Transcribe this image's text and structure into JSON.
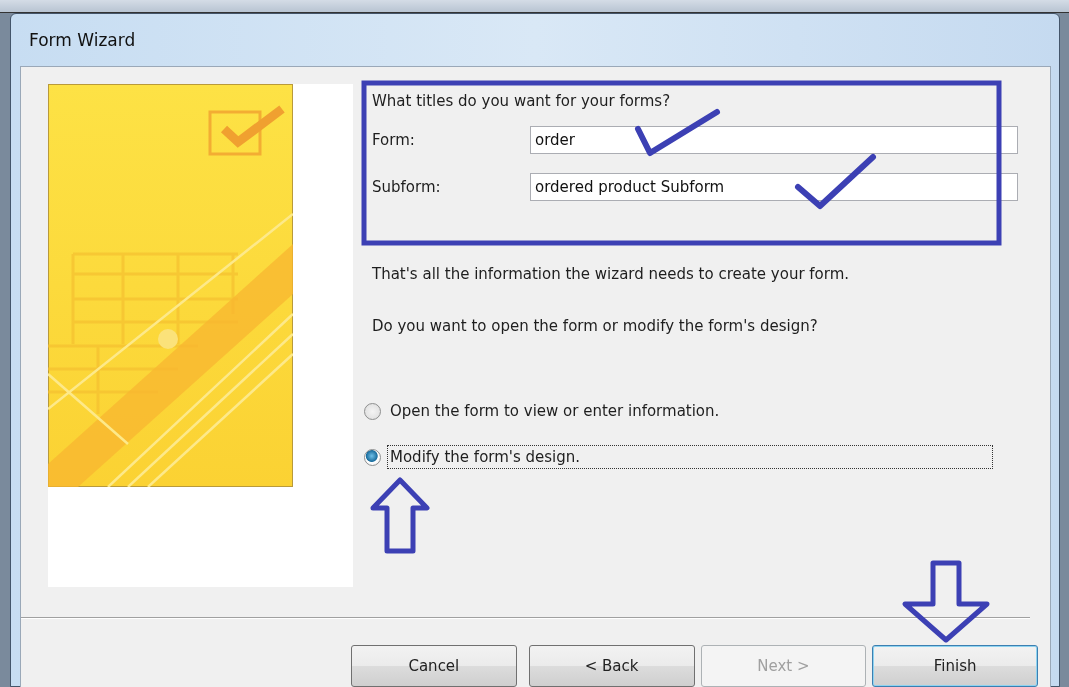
{
  "window": {
    "title": "Form Wizard"
  },
  "heading": "What titles do you want for your forms?",
  "fields": [
    {
      "label": "Form:",
      "value": "order"
    },
    {
      "label": "Subform:",
      "value": "ordered product Subform"
    }
  ],
  "messages": [
    "That's all the information the wizard needs to create your form.",
    "Do you want to open the form or modify the form's design?"
  ],
  "options": [
    {
      "label": "Open the form to view or enter information.",
      "selected": false
    },
    {
      "label": "Modify the form's design.",
      "selected": true
    }
  ],
  "buttons": [
    {
      "label": "Cancel",
      "disabled": false,
      "default": false
    },
    {
      "label": "< Back",
      "disabled": false,
      "default": false
    },
    {
      "label": "Next >",
      "disabled": true,
      "default": false
    },
    {
      "label": "Finish",
      "disabled": false,
      "default": true
    }
  ]
}
